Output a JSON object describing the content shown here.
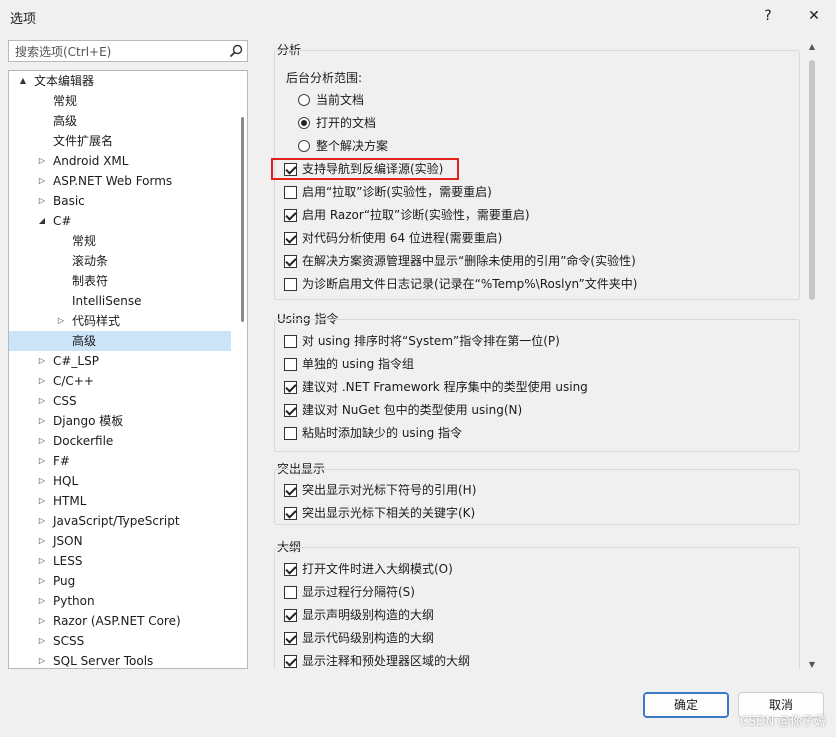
{
  "window": {
    "title": "选项",
    "help": "?",
    "close": "✕"
  },
  "search": {
    "placeholder": "搜索选项(Ctrl+E)"
  },
  "tree": [
    {
      "label": "文本编辑器",
      "arrow": "▲",
      "expanded": true
    },
    {
      "label": "常规"
    },
    {
      "label": "高级"
    },
    {
      "label": "文件扩展名"
    },
    {
      "label": "Android XML",
      "arrow": "▷"
    },
    {
      "label": "ASP.NET Web Forms",
      "arrow": "▷"
    },
    {
      "label": "Basic",
      "arrow": "▷"
    },
    {
      "label": "C#",
      "arrow": "◢"
    },
    {
      "label": "常规"
    },
    {
      "label": "滚动条"
    },
    {
      "label": "制表符"
    },
    {
      "label": "IntelliSense"
    },
    {
      "label": "代码样式",
      "arrow": "▷"
    },
    {
      "label": "高级",
      "selected": true
    },
    {
      "label": "C#_LSP",
      "arrow": "▷"
    },
    {
      "label": "C/C++",
      "arrow": "▷"
    },
    {
      "label": "CSS",
      "arrow": "▷"
    },
    {
      "label": "Django 模板",
      "arrow": "▷"
    },
    {
      "label": "Dockerfile",
      "arrow": "▷"
    },
    {
      "label": "F#",
      "arrow": "▷"
    },
    {
      "label": "HQL",
      "arrow": "▷"
    },
    {
      "label": "HTML",
      "arrow": "▷"
    },
    {
      "label": "JavaScript/TypeScript",
      "arrow": "▷"
    },
    {
      "label": "JSON",
      "arrow": "▷"
    },
    {
      "label": "LESS",
      "arrow": "▷"
    },
    {
      "label": "Pug",
      "arrow": "▷"
    },
    {
      "label": "Python",
      "arrow": "▷"
    },
    {
      "label": "Razor (ASP.NET Core)",
      "arrow": "▷"
    },
    {
      "label": "SCSS",
      "arrow": "▷"
    },
    {
      "label": "SQL Server Tools",
      "arrow": "▷"
    }
  ],
  "groups": {
    "analysis": {
      "title": "分析",
      "scope_label": "后台分析范围:",
      "radios": [
        {
          "label": "当前文档",
          "checked": false
        },
        {
          "label": "打开的文档",
          "checked": true
        },
        {
          "label": "整个解决方案",
          "checked": false
        }
      ],
      "checks": [
        {
          "label": "支持导航到反编译源(实验)",
          "checked": true
        },
        {
          "label": "启用“拉取”诊断(实验性，需要重启)",
          "checked": false
        },
        {
          "label": "启用 Razor“拉取”诊断(实验性，需要重启)",
          "checked": true
        },
        {
          "label": "对代码分析使用 64 位进程(需要重启)",
          "checked": true
        },
        {
          "label": "在解决方案资源管理器中显示“删除未使用的引用”命令(实验性)",
          "checked": true
        },
        {
          "label": "为诊断启用文件日志记录(记录在“%Temp%\\Roslyn”文件夹中)",
          "checked": false
        }
      ]
    },
    "using": {
      "title": "Using 指令",
      "checks": [
        {
          "label": "对 using 排序时将“System”指令排在第一位(P)",
          "checked": false
        },
        {
          "label": "单独的 using 指令组",
          "checked": false
        },
        {
          "label": "建议对 .NET Framework 程序集中的类型使用 using",
          "checked": true
        },
        {
          "label": "建议对 NuGet 包中的类型使用 using(N)",
          "checked": true
        },
        {
          "label": "粘贴时添加缺少的 using 指令",
          "checked": false
        }
      ]
    },
    "highlight": {
      "title": "突出显示",
      "checks": [
        {
          "label": "突出显示对光标下符号的引用(H)",
          "checked": true
        },
        {
          "label": "突出显示光标下相关的关键字(K)",
          "checked": true
        }
      ]
    },
    "outline": {
      "title": "大纲",
      "checks": [
        {
          "label": "打开文件时进入大纲模式(O)",
          "checked": true
        },
        {
          "label": "显示过程行分隔符(S)",
          "checked": false
        },
        {
          "label": "显示声明级别构造的大纲",
          "checked": true
        },
        {
          "label": "显示代码级别构造的大纲",
          "checked": true
        },
        {
          "label": "显示注释和预处理器区域的大纲",
          "checked": true
        }
      ]
    }
  },
  "buttons": {
    "ok": "确定",
    "cancel": "取消"
  },
  "watermark": "CSDN @你子薅",
  "colors": {
    "selection": "#cce4f7",
    "highlight_border": "#e0201b",
    "primary_border": "#3b78c6"
  }
}
